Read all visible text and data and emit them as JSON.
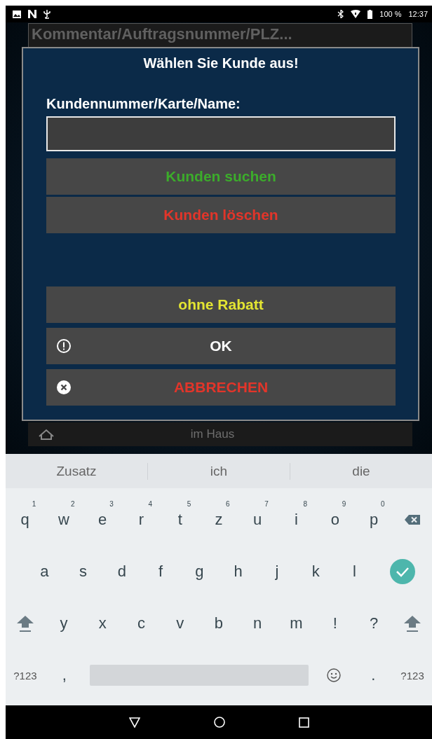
{
  "status_bar": {
    "battery": "100 %",
    "time": "12:37"
  },
  "background_field": {
    "placeholder": "Kommentar/Auftragsnummer/PLZ..."
  },
  "dialog": {
    "title": "Wählen Sie Kunde aus!",
    "field_label": "Kundennummer/Karte/Name:",
    "search_buttons": [
      {
        "label": "Kunden suchen",
        "kind": "search"
      },
      {
        "label": "Kunden löschen",
        "kind": "clear"
      }
    ],
    "action_buttons": [
      {
        "label": "ohne Rabatt",
        "kind": "discount"
      },
      {
        "label": "OK",
        "kind": "confirm"
      },
      {
        "label": "ABBRECHEN",
        "kind": "cancel"
      }
    ]
  },
  "background_row": {
    "label": "im Haus"
  },
  "keyboard": {
    "suggestions": [
      "Zusatz",
      "ich",
      "die"
    ],
    "rows": [
      {
        "keys": [
          {
            "kind": "letter",
            "label": "q",
            "hint": "1"
          },
          {
            "kind": "letter",
            "label": "w",
            "hint": "2"
          },
          {
            "kind": "letter",
            "label": "e",
            "hint": "3"
          },
          {
            "kind": "letter",
            "label": "r",
            "hint": "4"
          },
          {
            "kind": "letter",
            "label": "t",
            "hint": "5"
          },
          {
            "kind": "letter",
            "label": "z",
            "hint": "6"
          },
          {
            "kind": "letter",
            "label": "u",
            "hint": "7"
          },
          {
            "kind": "letter",
            "label": "i",
            "hint": "8"
          },
          {
            "kind": "letter",
            "label": "o",
            "hint": "9"
          },
          {
            "kind": "letter",
            "label": "p",
            "hint": "0"
          },
          {
            "kind": "backspace"
          }
        ]
      },
      {
        "keys": [
          {
            "kind": "gap"
          },
          {
            "kind": "letter",
            "label": "a"
          },
          {
            "kind": "letter",
            "label": "s"
          },
          {
            "kind": "letter",
            "label": "d"
          },
          {
            "kind": "letter",
            "label": "f"
          },
          {
            "kind": "letter",
            "label": "g"
          },
          {
            "kind": "letter",
            "label": "h"
          },
          {
            "kind": "letter",
            "label": "j"
          },
          {
            "kind": "letter",
            "label": "k"
          },
          {
            "kind": "letter",
            "label": "l"
          },
          {
            "kind": "enter"
          }
        ]
      },
      {
        "keys": [
          {
            "kind": "shift"
          },
          {
            "kind": "letter",
            "label": "y"
          },
          {
            "kind": "letter",
            "label": "x"
          },
          {
            "kind": "letter",
            "label": "c"
          },
          {
            "kind": "letter",
            "label": "v"
          },
          {
            "kind": "letter",
            "label": "b"
          },
          {
            "kind": "letter",
            "label": "n"
          },
          {
            "kind": "letter",
            "label": "m"
          },
          {
            "kind": "letter",
            "label": "!"
          },
          {
            "kind": "letter",
            "label": "?"
          },
          {
            "kind": "shift"
          }
        ]
      },
      {
        "keys": [
          {
            "kind": "mode",
            "label": "?123"
          },
          {
            "kind": "letter",
            "label": ","
          },
          {
            "kind": "space"
          },
          {
            "kind": "emoji"
          },
          {
            "kind": "letter",
            "label": "."
          },
          {
            "kind": "mode",
            "label": "?123"
          }
        ]
      }
    ]
  }
}
